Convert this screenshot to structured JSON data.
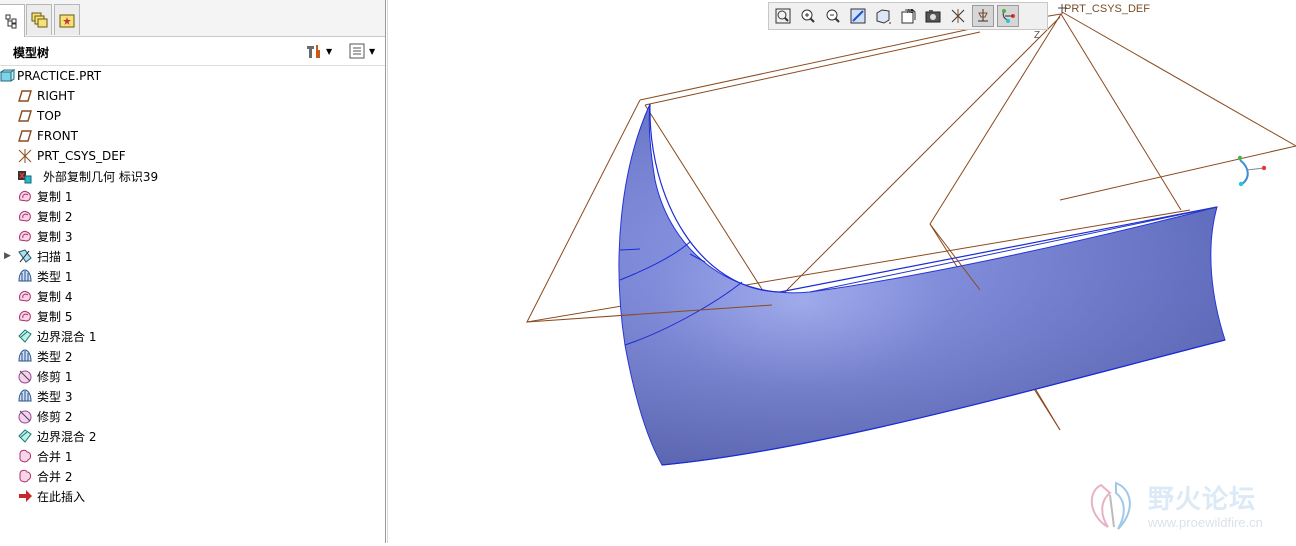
{
  "tabs": [
    {
      "name": "model-tree-tab",
      "active": true
    },
    {
      "name": "layers-tab",
      "active": false
    },
    {
      "name": "favorites-tab",
      "active": false
    }
  ],
  "header": {
    "title": "模型树"
  },
  "tree": [
    {
      "label": "PRACTICE.PRT",
      "icon": "part-icon",
      "indent": 0
    },
    {
      "label": "RIGHT",
      "icon": "datum-plane-icon",
      "indent": 1
    },
    {
      "label": "TOP",
      "icon": "datum-plane-icon",
      "indent": 1
    },
    {
      "label": "FRONT",
      "icon": "datum-plane-icon",
      "indent": 1
    },
    {
      "label": "PRT_CSYS_DEF",
      "icon": "csys-icon",
      "indent": 1
    },
    {
      "label": "外部复制几何 标识39",
      "icon": "external-copy-icon",
      "indent": 1
    },
    {
      "label": "复制 1",
      "icon": "copy-icon",
      "indent": 1
    },
    {
      "label": "复制 2",
      "icon": "copy-icon",
      "indent": 1
    },
    {
      "label": "复制 3",
      "icon": "copy-icon",
      "indent": 1
    },
    {
      "label": "扫描 1",
      "icon": "sweep-icon",
      "indent": 1,
      "expandable": true
    },
    {
      "label": "类型 1",
      "icon": "style-icon",
      "indent": 1
    },
    {
      "label": "复制 4",
      "icon": "copy-icon",
      "indent": 1
    },
    {
      "label": "复制 5",
      "icon": "copy-icon",
      "indent": 1
    },
    {
      "label": "边界混合 1",
      "icon": "boundary-blend-icon",
      "indent": 1
    },
    {
      "label": "类型 2",
      "icon": "style-icon",
      "indent": 1
    },
    {
      "label": "修剪 1",
      "icon": "trim-icon",
      "indent": 1
    },
    {
      "label": "类型 3",
      "icon": "style-icon",
      "indent": 1
    },
    {
      "label": "修剪 2",
      "icon": "trim-icon",
      "indent": 1
    },
    {
      "label": "边界混合 2",
      "icon": "boundary-blend-icon",
      "indent": 1
    },
    {
      "label": "合并 1",
      "icon": "merge-icon",
      "indent": 1
    },
    {
      "label": "合并 2",
      "icon": "merge-icon",
      "indent": 1
    },
    {
      "label": "在此插入",
      "icon": "insert-here-icon",
      "indent": 1
    }
  ],
  "toolbar": [
    {
      "name": "zoom-fit-icon"
    },
    {
      "name": "zoom-in-icon"
    },
    {
      "name": "zoom-out-icon"
    },
    {
      "name": "repaint-icon"
    },
    {
      "name": "display-style-icon"
    },
    {
      "name": "saved-views-icon"
    },
    {
      "name": "view-manager-icon"
    },
    {
      "name": "datum-planes-toggle-icon",
      "on": false
    },
    {
      "name": "datum-axes-toggle-icon",
      "on": true
    },
    {
      "name": "csys-toggle-icon",
      "on": true
    }
  ],
  "viewport": {
    "csys_label": "PRT_CSYS_DEF",
    "axis_label": "Z",
    "surface_color": "#7f8ee0",
    "datum_color": "#8b4a1e"
  },
  "watermark": {
    "title": "野火论坛",
    "url": "www.proewildfire.cn"
  }
}
